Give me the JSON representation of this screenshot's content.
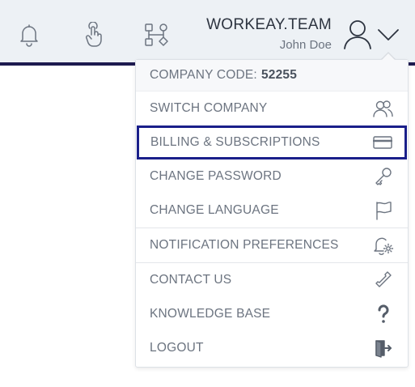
{
  "header": {
    "team_name": "WORKEAY.TEAM",
    "user_name": "John Doe",
    "icons": [
      "bell-icon",
      "touch-icon",
      "workflow-icon",
      "user-icon",
      "chevron-down-icon"
    ]
  },
  "menu": {
    "company_code_label": "COMPANY CODE:",
    "company_code_value": "52255",
    "items": [
      {
        "label": "SWITCH COMPANY",
        "icon": "users-icon"
      },
      {
        "label": "BILLING & SUBSCRIPTIONS",
        "icon": "credit-card-icon",
        "highlighted": true
      },
      {
        "label": "CHANGE PASSWORD",
        "icon": "key-icon"
      },
      {
        "label": "CHANGE LANGUAGE",
        "icon": "flag-icon"
      },
      {
        "label": "NOTIFICATION PREFERENCES",
        "icon": "bell-settings-icon"
      },
      {
        "label": "CONTACT US",
        "icon": "phone-icon"
      },
      {
        "label": "KNOWLEDGE BASE",
        "icon": "question-icon"
      },
      {
        "label": "LOGOUT",
        "icon": "logout-icon"
      }
    ]
  },
  "colors": {
    "topbar_bg": "#edf1f5",
    "topbar_accent": "#1e1a4f",
    "highlight_border": "#1a1f8a",
    "menu_text": "#6c7480"
  }
}
